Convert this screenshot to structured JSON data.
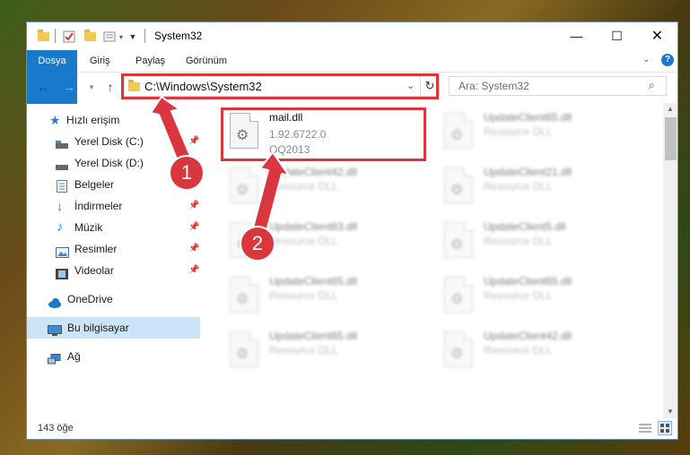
{
  "window": {
    "title": "System32"
  },
  "ribbon": {
    "tabs": [
      "Dosya",
      "Giriş",
      "Paylaş",
      "Görünüm"
    ]
  },
  "address": {
    "path": "C:\\Windows\\System32"
  },
  "search": {
    "placeholder": "Ara: System32"
  },
  "sidebar": {
    "items": [
      {
        "label": "Hızlı erişim",
        "icon": "star-icon"
      },
      {
        "label": "Yerel Disk (C:)",
        "icon": "drive-icon"
      },
      {
        "label": "Yerel Disk (D:)",
        "icon": "drive-icon"
      },
      {
        "label": "Belgeler",
        "icon": "documents-icon"
      },
      {
        "label": "İndirmeler",
        "icon": "download-icon"
      },
      {
        "label": "Müzik",
        "icon": "music-icon"
      },
      {
        "label": "Resimler",
        "icon": "pictures-icon"
      },
      {
        "label": "Videolar",
        "icon": "video-icon"
      },
      {
        "label": "OneDrive",
        "icon": "cloud-icon"
      },
      {
        "label": "Bu bilgisayar",
        "icon": "computer-icon"
      },
      {
        "label": "Ağ",
        "icon": "network-icon"
      }
    ]
  },
  "files": [
    {
      "name": "mail.dll",
      "line2": "1.92.6722.0",
      "line3": "QQ2013"
    },
    {
      "name": "UpdateClient65.dll",
      "line2": "Resource DLL"
    },
    {
      "name": "UpdateClient42.dll",
      "line2": "Resource DLL"
    },
    {
      "name": "UpdateClient21.dll",
      "line2": "Resource DLL"
    },
    {
      "name": "UpdateClient63.dll",
      "line2": "Resource DLL"
    },
    {
      "name": "UpdateClient5.dll",
      "line2": "Resource DLL"
    },
    {
      "name": "UpdateClient65.dll",
      "line2": "Resource DLL"
    },
    {
      "name": "UpdateClient65.dll",
      "line2": "Resource DLL"
    },
    {
      "name": "UpdateClient65.dll",
      "line2": "Resource DLL"
    },
    {
      "name": "UpdateClient42.dll",
      "line2": "Resource DLL"
    }
  ],
  "status": {
    "count": "143 öğe"
  },
  "callouts": [
    "1",
    "2"
  ],
  "colors": {
    "accent": "#1979ca",
    "highlight": "#d9363e",
    "selection": "#cce4f7"
  }
}
